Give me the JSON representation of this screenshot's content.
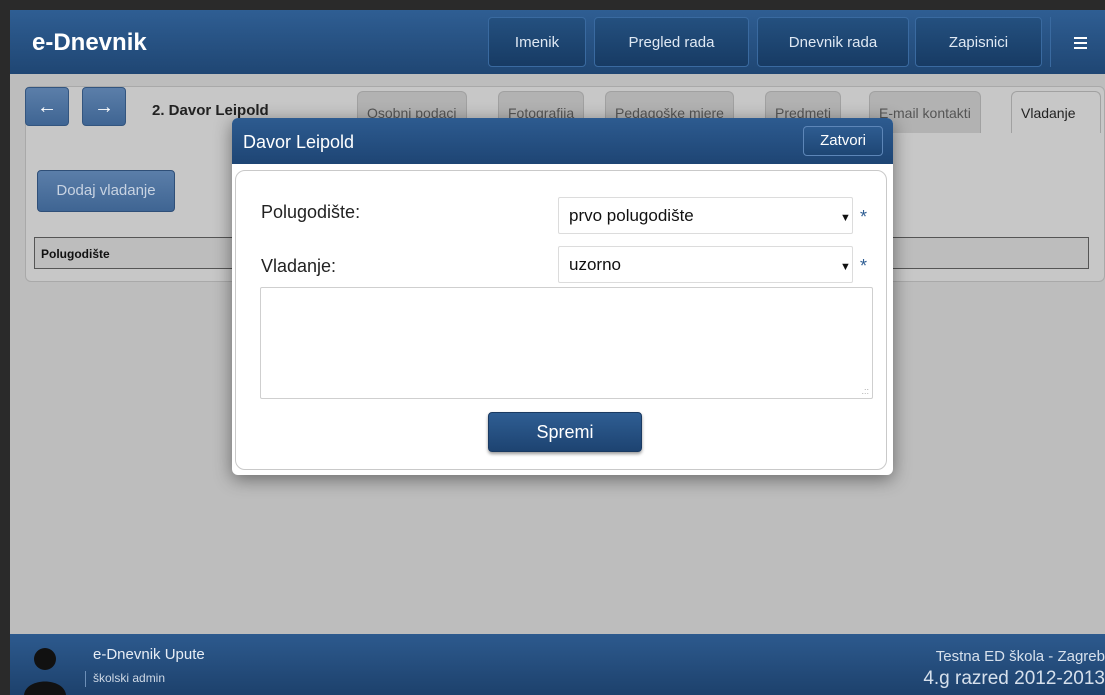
{
  "app": {
    "title": "e-Dnevnik"
  },
  "nav": {
    "items": [
      {
        "label": "Imenik"
      },
      {
        "label": "Pregled rada"
      },
      {
        "label": "Dnevnik rada"
      },
      {
        "label": "Zapisnici"
      }
    ],
    "menu_icon": "hamburger-menu-icon"
  },
  "student": {
    "prev_icon": "arrow-left-icon",
    "next_icon": "arrow-right-icon",
    "name": "2. Davor Leipold"
  },
  "tabs": [
    {
      "label": "Osobni podaci"
    },
    {
      "label": "Fotografija"
    },
    {
      "label": "Pedagoške mjere"
    },
    {
      "label": "Predmeti"
    },
    {
      "label": "E-mail kontakti"
    },
    {
      "label": "Vladanje",
      "active": true
    }
  ],
  "content": {
    "add_button": "Dodaj vladanje",
    "table_header": "Polugodište"
  },
  "modal": {
    "title": "Davor Leipold",
    "close_label": "Zatvori",
    "fields": [
      {
        "label": "Polugodište:",
        "value": "prvo polugodište",
        "required": "*"
      },
      {
        "label": "Vladanje:",
        "value": "uzorno",
        "required": "*"
      }
    ],
    "note_value": "",
    "save_label": "Spremi"
  },
  "footer": {
    "title": "e-Dnevnik Upute",
    "role": "školski admin",
    "school": "Testna ED škola - Zagreb",
    "class": "4.g razred 2012-2013"
  },
  "colors": {
    "primary": "#2f5e93",
    "primary_dark": "#1e4574",
    "overlay_gray": "#bdbdbd"
  }
}
